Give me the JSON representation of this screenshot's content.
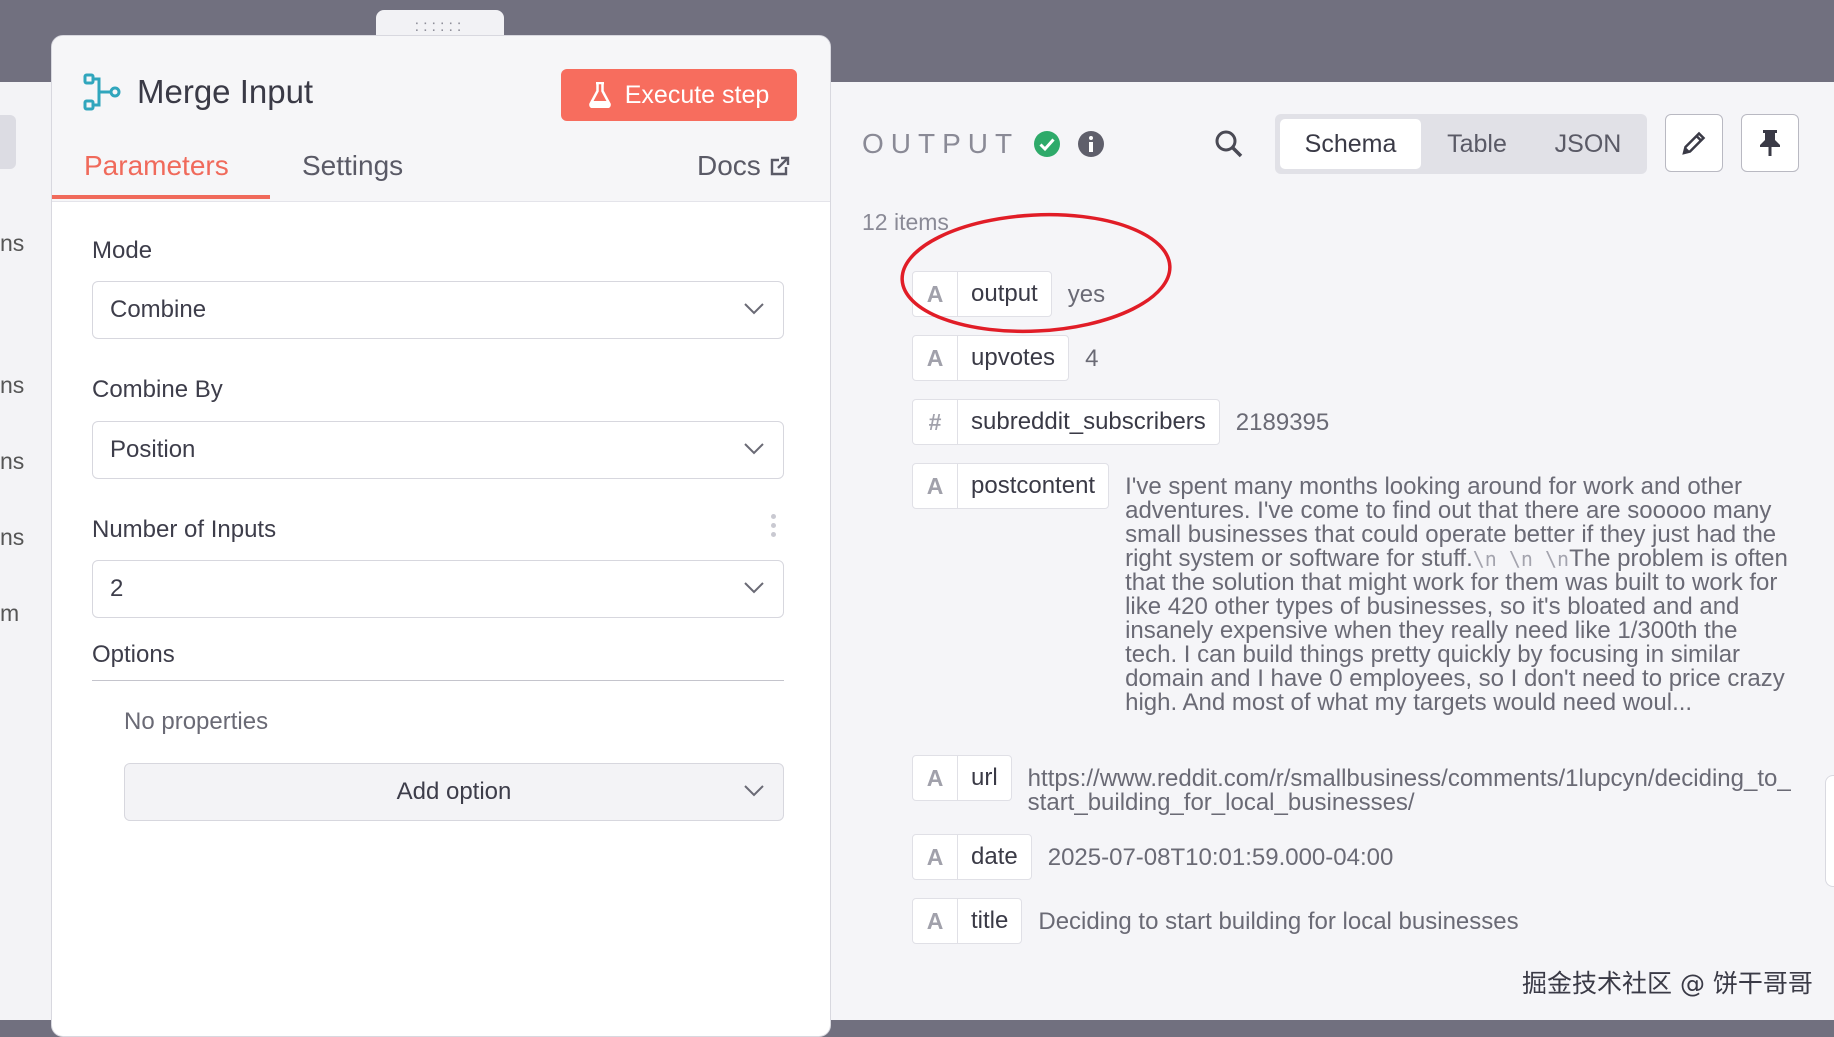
{
  "left_fragments": [
    "ns",
    "ns",
    "ns",
    "ns",
    "m"
  ],
  "node": {
    "icon": "merge-icon",
    "title": "Merge Input",
    "execute_label": "Execute step"
  },
  "tabs": {
    "parameters": "Parameters",
    "settings": "Settings",
    "docs": "Docs"
  },
  "params": {
    "mode": {
      "label": "Mode",
      "value": "Combine"
    },
    "combine_by": {
      "label": "Combine By",
      "value": "Position"
    },
    "number_of_inputs": {
      "label": "Number of Inputs",
      "value": "2"
    },
    "options": {
      "label": "Options",
      "empty_text": "No properties",
      "add_label": "Add option"
    }
  },
  "output": {
    "title": "OUTPUT",
    "views": [
      "Schema",
      "Table",
      "JSON"
    ],
    "active_view": "Schema",
    "item_count": "12 items",
    "fields": [
      {
        "type": "A",
        "key": "output",
        "value": "yes"
      },
      {
        "type": "A",
        "key": "upvotes",
        "value": "4"
      },
      {
        "type": "#",
        "key": "subreddit_subscribers",
        "value": "2189395"
      },
      {
        "type": "A",
        "key": "postcontent",
        "value_before": "I've spent many months looking around for work and other adventures. I've come to find out that there are sooooo many small businesses that could operate better if they just had the right system or software for stuff.",
        "newlines": "\\n \\n \\n",
        "value_after": "The problem is often that the solution that might work for them was built to work for like 420 other types of businesses, so it's bloated and and insanely expensive when they really need like 1/300th the tech. I can build things pretty quickly by focusing in similar domain and I have 0 employees, so I don't need to price crazy high. And most of what my targets would need woul..."
      },
      {
        "type": "A",
        "key": "url",
        "value": "https://www.reddit.com/r/smallbusiness/comments/1lupcyn/deciding_to_start_building_for_local_businesses/"
      },
      {
        "type": "A",
        "key": "date",
        "value": "2025-07-08T10:01:59.000-04:00"
      },
      {
        "type": "A",
        "key": "title",
        "value": "Deciding to start building for local businesses"
      }
    ]
  },
  "watermark": "掘金技术社区 @ 饼干哥哥",
  "colors": {
    "accent": "#f06a5b",
    "execute_bg": "#f76d5e",
    "success": "#2eaa6a",
    "annotation": "#e11d27",
    "canvas_bg": "#71707f"
  }
}
